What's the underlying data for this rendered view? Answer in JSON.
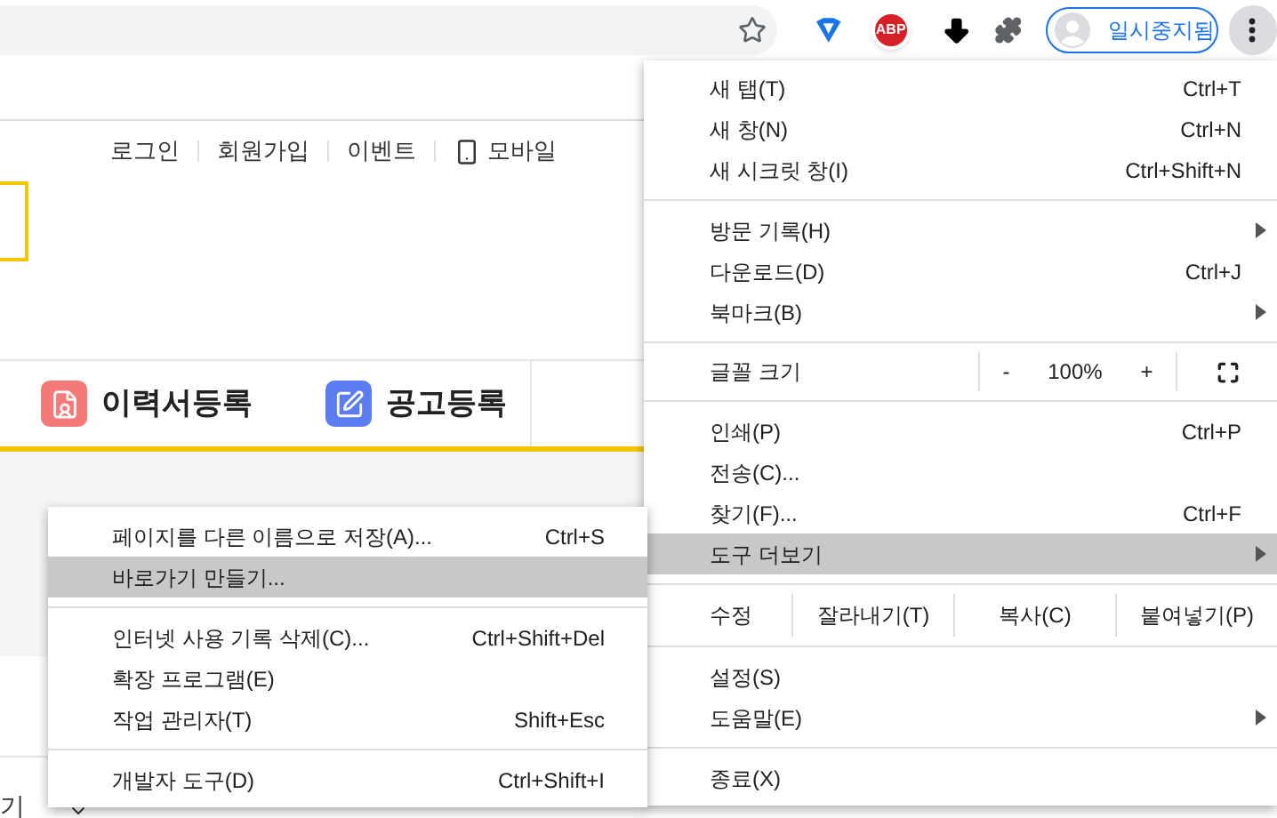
{
  "toolbar": {
    "extension_badge": "ABP",
    "profile": "일시중지됨"
  },
  "page": {
    "top_links": [
      "로그인",
      "회원가입",
      "이벤트",
      "모바일"
    ],
    "nav": [
      {
        "label": "이력서등록",
        "color": "#f47a7a"
      },
      {
        "label": "공고등록",
        "color": "#5b7cf0"
      }
    ],
    "bottom_fragment": "기"
  },
  "menu": {
    "items": [
      {
        "kind": "item",
        "label": "새 탭(T)",
        "shortcut": "Ctrl+T",
        "selected": false,
        "submenu": false
      },
      {
        "kind": "item",
        "label": "새 창(N)",
        "shortcut": "Ctrl+N",
        "selected": false,
        "submenu": false
      },
      {
        "kind": "item",
        "label": "새 시크릿 창(I)",
        "shortcut": "Ctrl+Shift+N",
        "selected": false,
        "submenu": false
      },
      {
        "kind": "separator"
      },
      {
        "kind": "item",
        "label": "방문 기록(H)",
        "selected": false,
        "submenu": true
      },
      {
        "kind": "item",
        "label": "다운로드(D)",
        "shortcut": "Ctrl+J",
        "selected": false,
        "submenu": false
      },
      {
        "kind": "item",
        "label": "북마크(B)",
        "selected": false,
        "submenu": true
      },
      {
        "kind": "separator"
      },
      {
        "kind": "zoom",
        "label": "글꼴 크기",
        "minus": "-",
        "level_text": "100%",
        "plus": "+"
      },
      {
        "kind": "separator"
      },
      {
        "kind": "item",
        "label": "인쇄(P)",
        "shortcut": "Ctrl+P",
        "selected": false,
        "submenu": false
      },
      {
        "kind": "item",
        "label": "전송(C)...",
        "selected": false,
        "submenu": false
      },
      {
        "kind": "item",
        "label": "찾기(F)...",
        "shortcut": "Ctrl+F",
        "selected": false,
        "submenu": false
      },
      {
        "kind": "item",
        "label": "도구 더보기",
        "selected": true,
        "submenu": true
      },
      {
        "kind": "separator"
      },
      {
        "kind": "edit",
        "label": "수정",
        "buttons": [
          "잘라내기(T)",
          "복사(C)",
          "붙여넣기(P)"
        ]
      },
      {
        "kind": "separator"
      },
      {
        "kind": "item",
        "label": "설정(S)",
        "selected": false,
        "submenu": false
      },
      {
        "kind": "item",
        "label": "도움말(E)",
        "selected": false,
        "submenu": true
      },
      {
        "kind": "separator"
      },
      {
        "kind": "item",
        "label": "종료(X)",
        "selected": false,
        "submenu": false
      }
    ]
  },
  "submenu": {
    "items": [
      {
        "kind": "item",
        "label": "페이지를 다른 이름으로 저장(A)...",
        "shortcut": "Ctrl+S",
        "selected": false,
        "submenu": false
      },
      {
        "kind": "item",
        "label": "바로가기 만들기...",
        "selected": true,
        "submenu": false
      },
      {
        "kind": "separator"
      },
      {
        "kind": "item",
        "label": "인터넷 사용 기록 삭제(C)...",
        "shortcut": "Ctrl+Shift+Del",
        "selected": false,
        "submenu": false
      },
      {
        "kind": "item",
        "label": "확장 프로그램(E)",
        "selected": false,
        "submenu": false
      },
      {
        "kind": "item",
        "label": "작업 관리자(T)",
        "shortcut": "Shift+Esc",
        "selected": false,
        "submenu": false
      },
      {
        "kind": "separator"
      },
      {
        "kind": "item",
        "label": "개발자 도구(D)",
        "shortcut": "Ctrl+Shift+I",
        "selected": false,
        "submenu": false
      }
    ]
  }
}
